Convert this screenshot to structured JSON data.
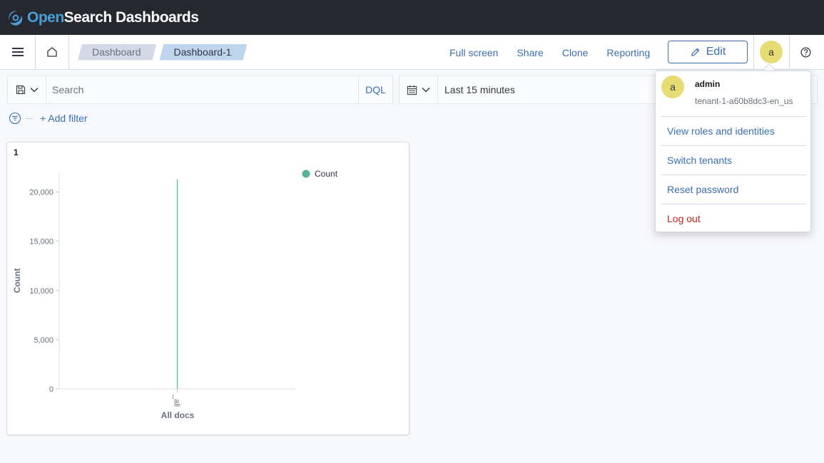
{
  "header": {
    "logo_open": "Open",
    "logo_rest": "Search Dashboards"
  },
  "nav": {
    "breadcrumbs": [
      "Dashboard",
      "Dashboard-1"
    ],
    "links": [
      "Full screen",
      "Share",
      "Clone",
      "Reporting"
    ],
    "edit_label": "Edit",
    "avatar_initial": "a"
  },
  "query": {
    "placeholder": "Search",
    "language": "DQL",
    "time_range": "Last 15 minutes",
    "add_filter": "+ Add filter"
  },
  "panel": {
    "title": "1"
  },
  "chart_data": {
    "type": "bar",
    "categories": [
      "_all"
    ],
    "values": [
      21300
    ],
    "series": [
      {
        "name": "Count",
        "values": [
          21300
        ]
      }
    ],
    "xlabel": "All docs",
    "ylabel": "Count",
    "yticks": [
      "0",
      "5,000",
      "10,000",
      "15,000",
      "20,000"
    ],
    "ytick_values": [
      0,
      5000,
      10000,
      15000,
      20000
    ],
    "ylim": [
      0,
      22000
    ],
    "legend_position": "top-right",
    "colors": {
      "Count": "#54b399"
    }
  },
  "user_menu": {
    "avatar_initial": "a",
    "username": "admin",
    "tenant": "tenant-1-a60b8dc3-en_us",
    "items": [
      "View roles and identities",
      "Switch tenants",
      "Reset password"
    ],
    "logout": "Log out"
  },
  "colors": {
    "header_bg": "#25282f",
    "link": "#3b6fb0",
    "avatar_bg": "#e6dc73",
    "logout": "#bd271e"
  }
}
